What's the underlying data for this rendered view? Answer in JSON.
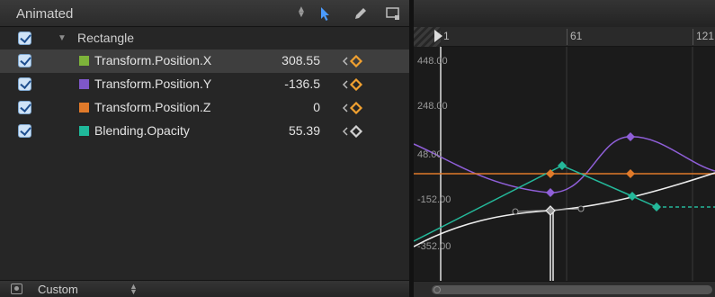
{
  "left_panel": {
    "title": "Animated",
    "group_label": "Rectangle",
    "rows": [
      {
        "name": "Transform.Position.X",
        "value": "308.55",
        "swatch": "#7db33a",
        "selected": true,
        "kf_color": "#f0a030"
      },
      {
        "name": "Transform.Position.Y",
        "value": "-136.5",
        "swatch": "#7e57c9",
        "selected": false,
        "kf_color": "#f0a030"
      },
      {
        "name": "Transform.Position.Z",
        "value": "0",
        "swatch": "#e07a2a",
        "selected": false,
        "kf_color": "#f0a030"
      },
      {
        "name": "Blending.Opacity",
        "value": "55.39",
        "swatch": "#1fb89a",
        "selected": false,
        "kf_color": "#d0d0d0"
      }
    ],
    "footer_label": "Custom"
  },
  "graph": {
    "ruler_ticks": [
      "1",
      "61",
      "121"
    ],
    "y_labels": [
      "448.00",
      "248.00",
      "48.00",
      "-152.00",
      "-352.00"
    ],
    "colors": {
      "x_curve": "#e8e8e8",
      "y_curve": "#8f5fd8",
      "z_curve": "#e07a2a",
      "opacity_curve": "#24b89a"
    }
  },
  "icons": {
    "sort": "up-down-arrows-icon",
    "arrow_tool": "arrow-pointer-icon",
    "pen_tool": "pen-icon",
    "frame_tool": "frame-select-icon",
    "keyframe": "diamond-icon",
    "prev_key": "chevron-left-icon"
  }
}
